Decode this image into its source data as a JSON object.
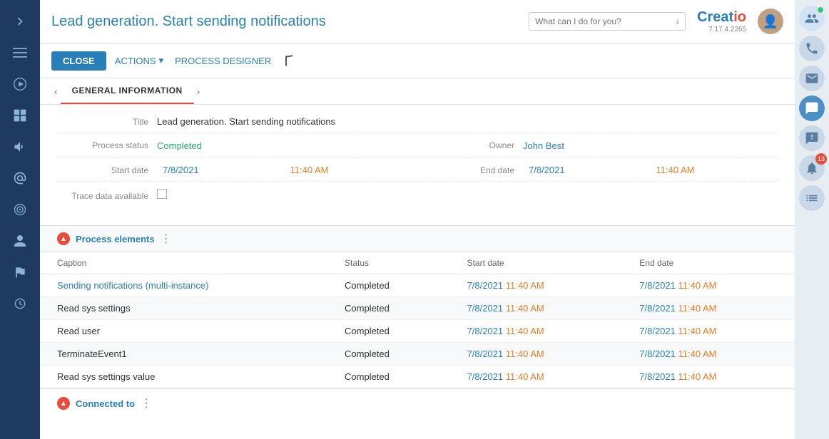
{
  "sidebar": {
    "items": [
      {
        "id": "expand",
        "icon": "chevron-right"
      },
      {
        "id": "menu",
        "icon": "menu"
      },
      {
        "id": "play",
        "icon": "play"
      },
      {
        "id": "grid",
        "icon": "grid"
      },
      {
        "id": "megaphone",
        "icon": "megaphone"
      },
      {
        "id": "at",
        "icon": "at"
      },
      {
        "id": "target",
        "icon": "target"
      },
      {
        "id": "user",
        "icon": "user"
      },
      {
        "id": "flag",
        "icon": "flag"
      },
      {
        "id": "circle",
        "icon": "circle"
      }
    ]
  },
  "header": {
    "title": "Lead generation. Start sending notifications",
    "search_placeholder": "What can I do for you?",
    "logo": "Creatio",
    "version": "7.17.4.2265"
  },
  "toolbar": {
    "close_label": "CLOSE",
    "actions_label": "ACTIONS",
    "process_designer_label": "PROCESS DESIGNER"
  },
  "tabs": [
    {
      "id": "general",
      "label": "GENERAL INFORMATION",
      "active": true
    }
  ],
  "form": {
    "title_label": "Title",
    "title_value": "Lead generation. Start sending notifications",
    "process_status_label": "Process status",
    "process_status_value": "Completed",
    "owner_label": "Owner",
    "owner_value": "John Best",
    "start_date_label": "Start date",
    "start_date_value": "7/8/2021",
    "start_time_value": "11:40 AM",
    "end_date_label": "End date",
    "end_date_value": "7/8/2021",
    "end_time_value": "11:40 AM",
    "trace_label": "Trace data available"
  },
  "process_elements": {
    "section_title": "Process elements",
    "columns": [
      "Caption",
      "Status",
      "Start date",
      "End date"
    ],
    "rows": [
      {
        "caption": "Sending notifications (multi-instance)",
        "caption_link": true,
        "status": "Completed",
        "start_date": "7/8/2021",
        "start_time": "11:40 AM",
        "end_date": "7/8/2021",
        "end_time": "11:40 AM"
      },
      {
        "caption": "Read sys settings",
        "caption_link": false,
        "status": "Completed",
        "start_date": "7/8/2021",
        "start_time": "11:40 AM",
        "end_date": "7/8/2021",
        "end_time": "11:40 AM"
      },
      {
        "caption": "Read user",
        "caption_link": false,
        "status": "Completed",
        "start_date": "7/8/2021",
        "start_time": "11:40 AM",
        "end_date": "7/8/2021",
        "end_time": "11:40 AM"
      },
      {
        "caption": "TerminateEvent1",
        "caption_link": false,
        "status": "Completed",
        "start_date": "7/8/2021",
        "start_time": "11:40 AM",
        "end_date": "7/8/2021",
        "end_time": "11:40 AM"
      },
      {
        "caption": "Read sys settings value",
        "caption_link": false,
        "status": "Completed",
        "start_date": "7/8/2021",
        "start_time": "11:40 AM",
        "end_date": "7/8/2021",
        "end_time": "11:40 AM"
      }
    ]
  },
  "connected_to": {
    "section_title": "Connected to"
  },
  "right_sidebar": {
    "buttons": [
      {
        "id": "users",
        "icon": "👥",
        "active": false
      },
      {
        "id": "phone",
        "icon": "📞",
        "active": false
      },
      {
        "id": "mail",
        "icon": "✉️",
        "active": false
      },
      {
        "id": "chat",
        "icon": "💬",
        "active": true
      },
      {
        "id": "support",
        "icon": "💬",
        "active": false
      },
      {
        "id": "bell",
        "icon": "🔔",
        "active": false,
        "badge": "13"
      },
      {
        "id": "list",
        "icon": "📋",
        "active": false
      }
    ]
  }
}
